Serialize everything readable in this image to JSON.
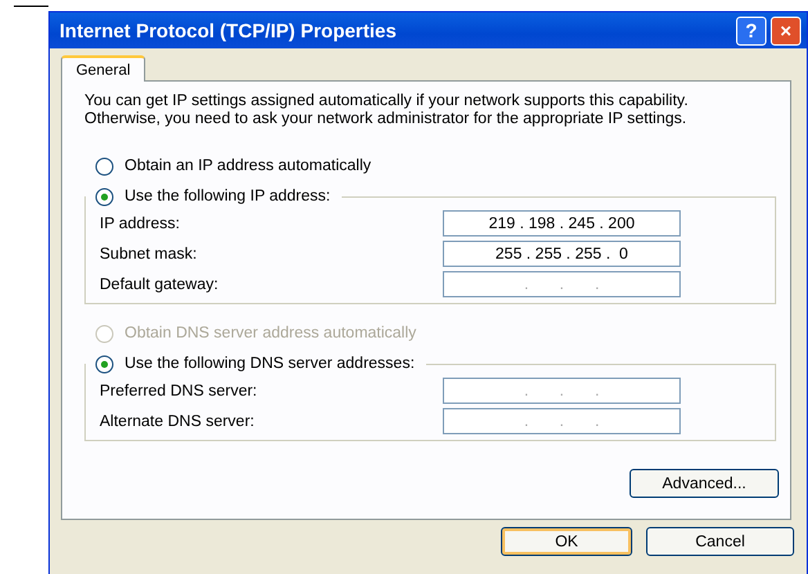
{
  "window": {
    "title": "Internet Protocol (TCP/IP) Properties",
    "help_button": "?",
    "close_button": "×"
  },
  "tabs": [
    {
      "label": "General",
      "selected": true
    }
  ],
  "intro": "You can get IP settings assigned automatically if your network supports this capability. Otherwise, you need to ask your network administrator for the appropriate IP settings.",
  "ip_options": [
    {
      "label": "Obtain an IP address automatically",
      "selected": false,
      "disabled": false,
      "kind": "radio"
    },
    {
      "label": "Use the following IP address:",
      "selected": true,
      "disabled": false,
      "kind": "group"
    }
  ],
  "ip_fields": [
    {
      "label": "IP address:",
      "value": "219 . 198 . 245 . 200",
      "empty": false
    },
    {
      "label": "Subnet mask:",
      "value": "255 . 255 . 255 .  0",
      "empty": false
    },
    {
      "label": "Default gateway:",
      "value": ".       .       .",
      "empty": true
    }
  ],
  "dns_options": [
    {
      "label": "Obtain DNS server address automatically",
      "selected": false,
      "disabled": true,
      "kind": "radio"
    },
    {
      "label": "Use the following DNS server addresses:",
      "selected": true,
      "disabled": false,
      "kind": "group"
    }
  ],
  "dns_fields": [
    {
      "label": "Preferred DNS server:",
      "value": ".       .       .",
      "empty": true
    },
    {
      "label": "Alternate DNS server:",
      "value": ".       .       .",
      "empty": true
    }
  ],
  "advanced_button": "Advanced...",
  "buttons": [
    {
      "label": "OK",
      "default": true
    },
    {
      "label": "Cancel",
      "default": false
    }
  ]
}
